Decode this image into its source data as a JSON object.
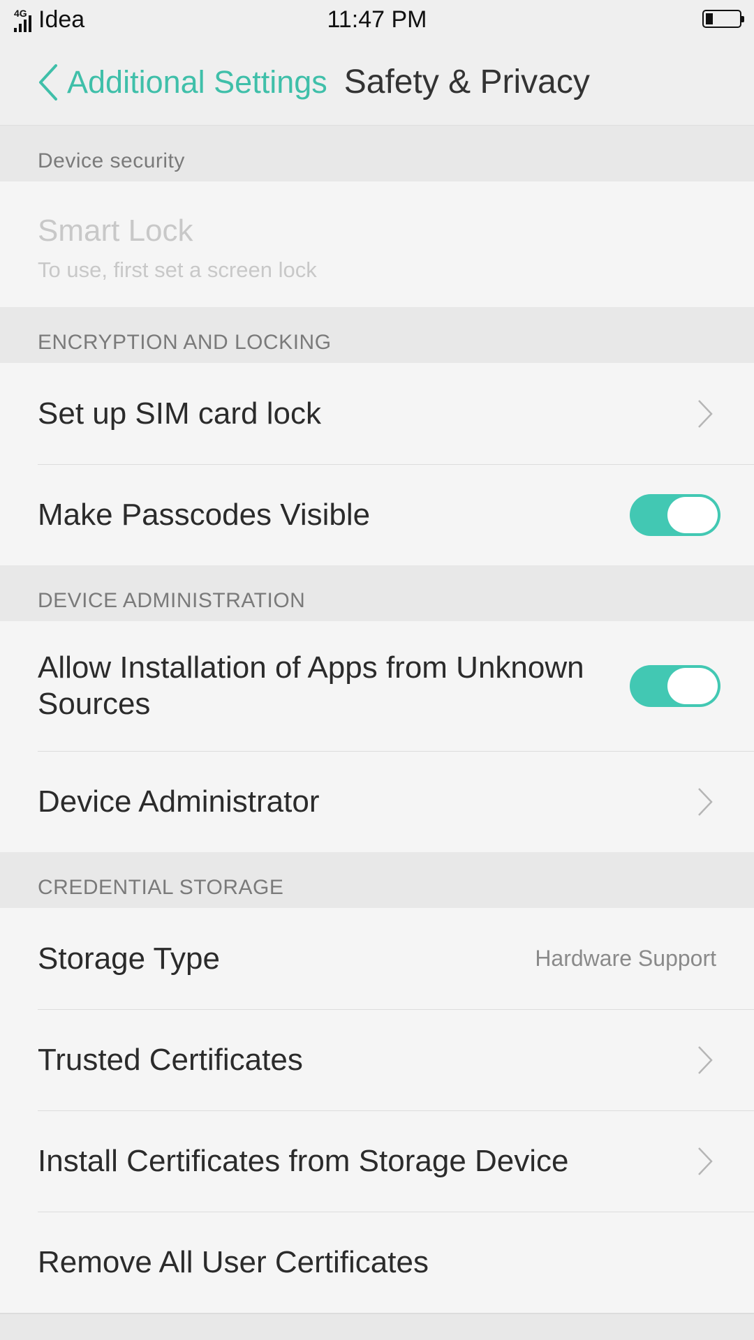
{
  "status_bar": {
    "network": "4G",
    "carrier": "Idea",
    "time": "11:47 PM"
  },
  "header": {
    "back_label": "Additional Settings",
    "title": "Safety & Privacy"
  },
  "sections": {
    "device_security": {
      "header": "Device security",
      "smart_lock_title": "Smart Lock",
      "smart_lock_subtitle": "To use, first set a screen lock"
    },
    "encryption": {
      "header": "ENCRYPTION AND LOCKING",
      "sim_lock": "Set up SIM card lock",
      "passcodes_visible": "Make Passcodes Visible",
      "passcodes_visible_on": true
    },
    "device_admin": {
      "header": "DEVICE ADMINISTRATION",
      "unknown_sources": "Allow Installation of Apps from Unknown Sources",
      "unknown_sources_on": true,
      "device_administrator": "Device Administrator"
    },
    "credential_storage": {
      "header": "CREDENTIAL STORAGE",
      "storage_type": "Storage Type",
      "storage_type_value": "Hardware Support",
      "trusted_certificates": "Trusted Certificates",
      "install_certificates": "Install Certificates from Storage Device",
      "remove_certificates": "Remove All User Certificates"
    }
  },
  "colors": {
    "accent": "#3fbfa9",
    "toggle_on": "#42c8b3"
  },
  "icons": {
    "back": "chevron-left-icon",
    "row_chevron": "chevron-right-icon"
  }
}
